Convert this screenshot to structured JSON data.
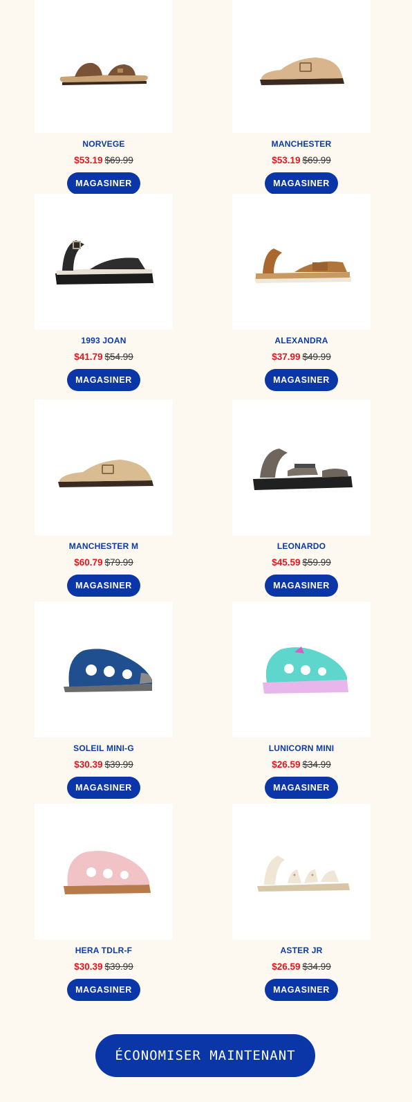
{
  "products": [
    {
      "name": "NORVEGE",
      "sale_price": "$53.19",
      "original_price": "$69.99",
      "button_label": "MAGASINER",
      "image": "brown-two-strap-sandal"
    },
    {
      "name": "MANCHESTER",
      "sale_price": "$53.19",
      "original_price": "$69.99",
      "button_label": "MAGASINER",
      "image": "tan-clog"
    },
    {
      "name": "1993 JOAN",
      "sale_price": "$41.79",
      "original_price": "$54.99",
      "button_label": "MAGASINER",
      "image": "black-platform-sandal"
    },
    {
      "name": "ALEXANDRA",
      "sale_price": "$37.99",
      "original_price": "$49.99",
      "button_label": "MAGASINER",
      "image": "tan-velcro-sandal"
    },
    {
      "name": "MANCHESTER M",
      "sale_price": "$60.79",
      "original_price": "$79.99",
      "button_label": "MAGASINER",
      "image": "tan-clog"
    },
    {
      "name": "LEONARDO",
      "sale_price": "$45.59",
      "original_price": "$59.99",
      "button_label": "MAGASINER",
      "image": "grey-sport-sandal"
    },
    {
      "name": "SOLEIL MINI-G",
      "sale_price": "$30.39",
      "original_price": "$39.99",
      "button_label": "MAGASINER",
      "image": "blue-fisherman-sandal"
    },
    {
      "name": "LUNICORN MINI",
      "sale_price": "$26.59",
      "original_price": "$34.99",
      "button_label": "MAGASINER",
      "image": "teal-light-up-sandal"
    },
    {
      "name": "HERA TDLR-F",
      "sale_price": "$30.39",
      "original_price": "$39.99",
      "button_label": "MAGASINER",
      "image": "pink-fisherman-sandal"
    },
    {
      "name": "ASTER JR",
      "sale_price": "$26.59",
      "original_price": "$34.99",
      "button_label": "MAGASINER",
      "image": "cream-strappy-sandal"
    }
  ],
  "cta": {
    "label": "ÉCONOMISER MAINTENANT"
  },
  "colors": {
    "background": "#fdf9f1",
    "accent": "#0a36a8",
    "sale": "#e3161e",
    "name": "#0a3aa8"
  }
}
